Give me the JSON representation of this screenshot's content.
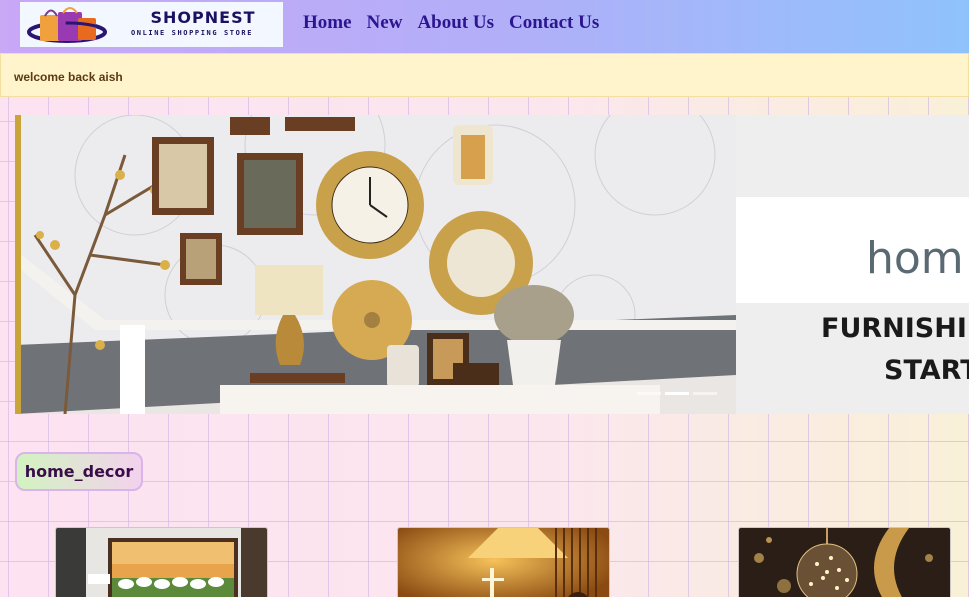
{
  "header": {
    "logo": {
      "title": "SHOPNEST",
      "subtitle": "ONLINE SHOPPING STORE"
    },
    "nav": [
      {
        "label": "Home"
      },
      {
        "label": "New"
      },
      {
        "label": "About Us"
      },
      {
        "label": "Contact Us"
      }
    ]
  },
  "welcome_message": "welcome back aish",
  "carousel": {
    "next_slide_text": {
      "brand": "hom",
      "line1": "FURNISHI",
      "line2": "START"
    },
    "indicators_count": 3,
    "active_indicator": 2
  },
  "category": {
    "label": "home_decor"
  },
  "products": [
    {
      "image": "wall-art-horses"
    },
    {
      "image": "table-lamp"
    },
    {
      "image": "glass-globe-lights"
    }
  ],
  "colors": {
    "nav_text": "#2c1590",
    "welcome_bg": "#fff4cc",
    "welcome_text": "#5a3a10",
    "category_text": "#3a0d4a"
  }
}
